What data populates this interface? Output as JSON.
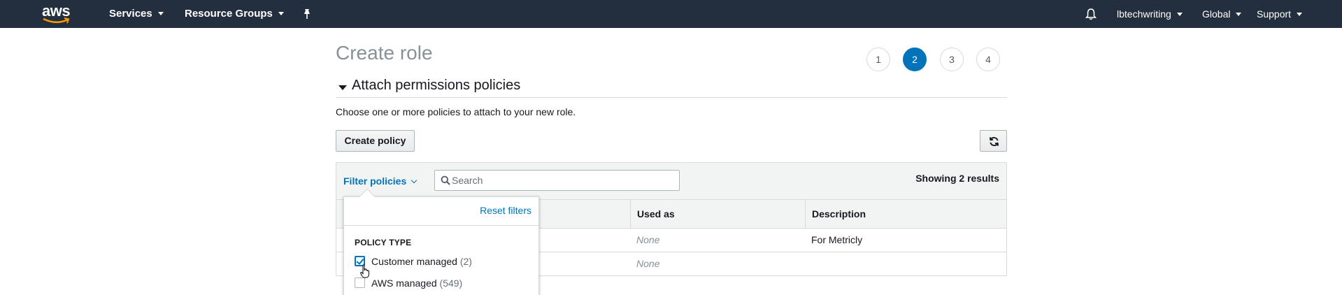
{
  "topnav": {
    "logo": "aws",
    "services_label": "Services",
    "resource_groups_label": "Resource Groups",
    "account_label": "lbtechwriting",
    "region_label": "Global",
    "support_label": "Support",
    "bg_color": "#232f3e"
  },
  "page": {
    "title": "Create role",
    "steps": [
      "1",
      "2",
      "3",
      "4"
    ],
    "active_step": "2"
  },
  "section": {
    "title": "Attach permissions policies",
    "description": "Choose one or more policies to attach to your new role."
  },
  "toolbar": {
    "create_policy_label": "Create policy",
    "filter_label": "Filter policies",
    "search_placeholder": "Search",
    "search_value": "",
    "results_text": "Showing 2 results"
  },
  "table": {
    "columns": [
      "Used as",
      "Description"
    ],
    "rows": [
      {
        "used_as": "None",
        "description": "For Metricly"
      },
      {
        "used_as": "None",
        "description": ""
      }
    ]
  },
  "filter_dropdown": {
    "reset_label": "Reset filters",
    "heading": "POLICY TYPE",
    "options": [
      {
        "label": "Customer managed",
        "count": "(2)",
        "checked": true
      },
      {
        "label": "AWS managed",
        "count": "(549)",
        "checked": false
      }
    ]
  },
  "colors": {
    "accent": "#0073bb",
    "border": "#d5dbdb",
    "title_gray": "#879196"
  },
  "icons": {
    "logo": "aws-smile-logo-icon",
    "pin": "pin-icon",
    "notifications": "bell-icon",
    "refresh": "refresh-icon",
    "search": "search-icon",
    "cursor": "hand-pointer-icon"
  }
}
